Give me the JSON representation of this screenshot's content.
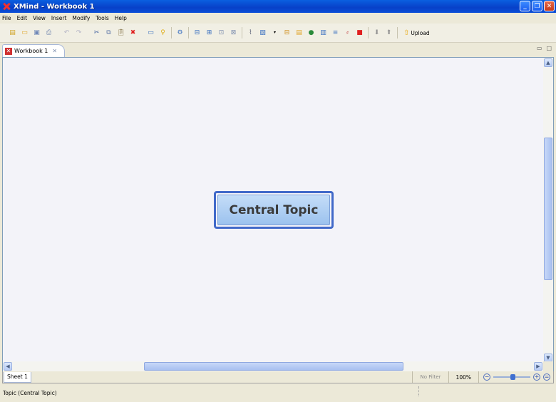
{
  "window": {
    "title": "XMind - Workbook 1",
    "buttons": [
      "_",
      "❐",
      "✕"
    ]
  },
  "menu": [
    "File",
    "Edit",
    "View",
    "Insert",
    "Modify",
    "Tools",
    "Help"
  ],
  "toolbar": {
    "icons": [
      "new-icon",
      "open-icon",
      "save-icon",
      "print-icon",
      "undo-icon",
      "redo-icon",
      "cut-icon",
      "copy-icon",
      "paste-icon",
      "delete-icon",
      "presentation-icon",
      "idea-icon",
      "brainstorm-icon",
      "topic-icon",
      "subtopic-icon",
      "callout-icon",
      "floating-topic-icon",
      "attachment-icon",
      "image-icon",
      "dropdown-icon",
      "boundary-icon",
      "note-icon",
      "marker-icon",
      "summary-icon",
      "relationship-icon",
      "label-icon",
      "stop-icon",
      "drill-down-icon",
      "drill-up-icon"
    ],
    "upload_label": "Upload"
  },
  "tab": {
    "label": "Workbook 1",
    "close": "✕"
  },
  "canvas": {
    "central_topic": "Central Topic"
  },
  "sheetbar": {
    "sheet_tab": "Sheet 1",
    "filter": "No Filter",
    "zoom": "100%"
  },
  "status": {
    "text": "Topic (Central Topic)"
  },
  "colors": {
    "titlebar": "#0a4fd8",
    "topic_border": "#4169c9",
    "topic_fill": "#b0d0f4"
  }
}
